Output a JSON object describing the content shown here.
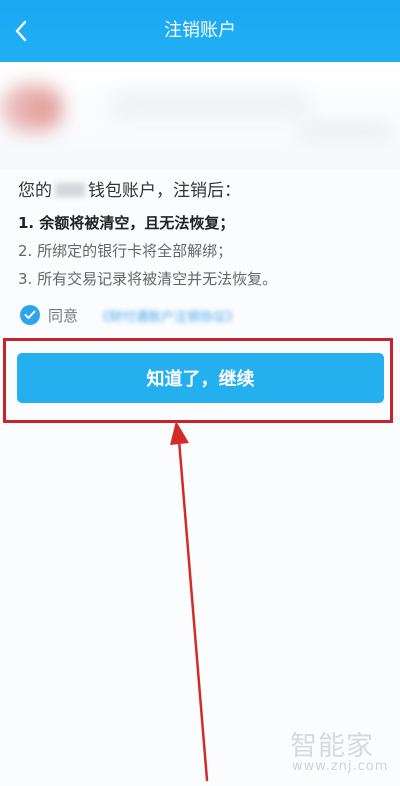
{
  "header": {
    "title": "注销账户",
    "back_icon": "chevron-left-icon",
    "background": "#1aa7f3"
  },
  "intro": {
    "prefix": "您的",
    "suffix": "钱包账户，注销后："
  },
  "rules": [
    "1. 余额将被清空，且无法恢复；",
    "2. 所绑定的银行卡将全部解绑；",
    "3. 所有交易记录将被清空并无法恢复。"
  ],
  "agreement": {
    "label": "同意",
    "checked": true,
    "link_text": "《财付通账户注销协议》"
  },
  "primary_button": {
    "label": "知道了，继续",
    "color": "#24b0ee"
  },
  "annotation": {
    "highlight_color": "#c62429"
  },
  "watermark": {
    "brand": "智能家",
    "url": "www.znj.com"
  }
}
